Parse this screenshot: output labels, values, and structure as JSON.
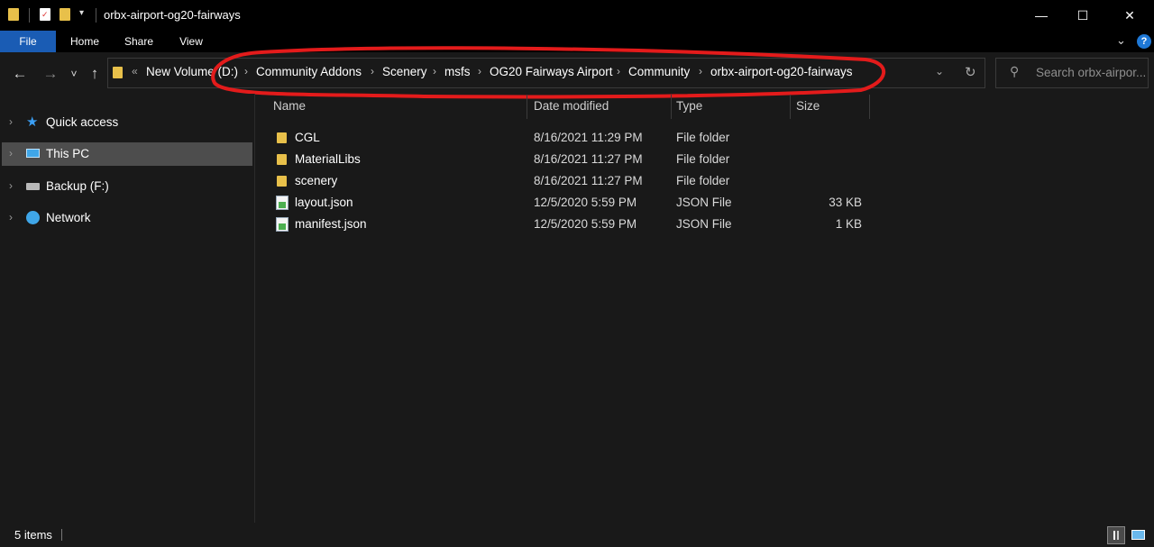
{
  "window": {
    "title": "orbx-airport-og20-fairways",
    "minimize_glyph": "—",
    "maximize_glyph": "☐",
    "close_glyph": "✕"
  },
  "ribbon": {
    "tabs": [
      {
        "label": "File",
        "active": true
      },
      {
        "label": "Home"
      },
      {
        "label": "Share"
      },
      {
        "label": "View"
      }
    ],
    "accent_color": "#1a5cb4"
  },
  "navigation": {
    "back": "←",
    "forward": "→",
    "recent": "˅",
    "up": "↑",
    "overflow": "«",
    "breadcrumbs": [
      "New Volume (D:)",
      "Community Addons",
      "Scenery",
      "msfs",
      "OG20 Fairways Airport",
      "Community",
      "orbx-airport-og20-fairways"
    ],
    "search_placeholder": "Search orbx-airpor...",
    "annotation_color": "#e31b1b"
  },
  "sidebar": {
    "items": [
      {
        "label": "Quick access",
        "icon": "star-icon",
        "selected": false
      },
      {
        "label": "This PC",
        "icon": "computer-icon",
        "selected": true
      },
      {
        "label": "Backup (F:)",
        "icon": "drive-icon",
        "selected": false
      },
      {
        "label": "Network",
        "icon": "network-icon",
        "selected": false
      }
    ]
  },
  "file_list": {
    "columns": [
      "Name",
      "Date modified",
      "Type",
      "Size"
    ],
    "rows": [
      {
        "name": "CGL",
        "date": "8/16/2021 11:29 PM",
        "type": "File folder",
        "size": "",
        "icon": "folder-icon"
      },
      {
        "name": "MaterialLibs",
        "date": "8/16/2021 11:27 PM",
        "type": "File folder",
        "size": "",
        "icon": "folder-icon"
      },
      {
        "name": "scenery",
        "date": "8/16/2021 11:27 PM",
        "type": "File folder",
        "size": "",
        "icon": "folder-icon"
      },
      {
        "name": "layout.json",
        "date": "12/5/2020 5:59 PM",
        "type": "JSON File",
        "size": "33 KB",
        "icon": "json-file-icon"
      },
      {
        "name": "manifest.json",
        "date": "12/5/2020 5:59 PM",
        "type": "JSON File",
        "size": "1 KB",
        "icon": "json-file-icon"
      }
    ]
  },
  "status": {
    "item_count": "5 items"
  },
  "colors": {
    "background": "#191919",
    "titlebar": "#000000",
    "selection": "#4d4d4d",
    "folder": "#e8c04a"
  }
}
